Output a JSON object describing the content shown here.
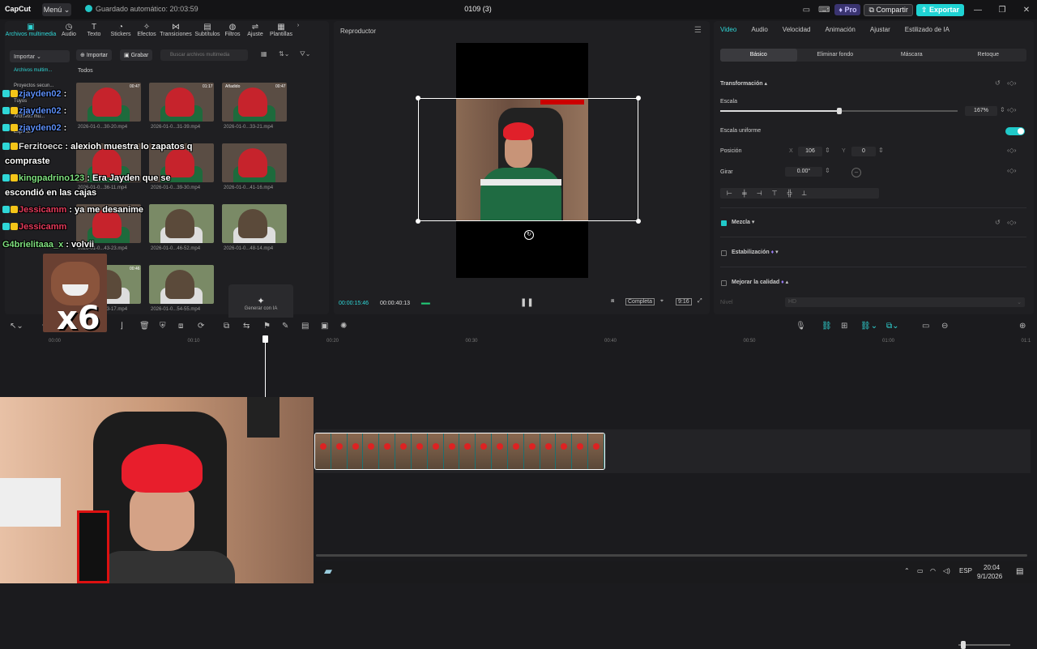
{
  "titlebar": {
    "logo": "CapCut",
    "menu": "Menú",
    "autosave": "Guardado automático: 20:03:59",
    "project": "0109 (3)",
    "pro": "Pro",
    "share": "Compartir",
    "export": "Exportar"
  },
  "left": {
    "tabs": [
      {
        "label": "Archivos multimedia",
        "icon": "media-icon"
      },
      {
        "label": "Audio",
        "icon": "audio-icon"
      },
      {
        "label": "Texto",
        "icon": "text-icon"
      },
      {
        "label": "Stickers",
        "icon": "sticker-icon"
      },
      {
        "label": "Efectos",
        "icon": "effects-icon"
      },
      {
        "label": "Transiciones",
        "icon": "transition-icon"
      },
      {
        "label": "Subtítulos",
        "icon": "subtitle-icon"
      },
      {
        "label": "Filtros",
        "icon": "filter-icon"
      },
      {
        "label": "Ajuste",
        "icon": "adjust-icon"
      },
      {
        "label": "Plantillas",
        "icon": "template-icon"
      }
    ],
    "sidebar": {
      "import": "Importar",
      "items": [
        "Archivos multim...",
        "Proyectos secun...",
        "Tuyos",
        "Archivos mu...",
        "Espacios"
      ]
    },
    "import_btn": "Importar",
    "record_btn": "Grabar",
    "search_placeholder": "Buscar archivos multimedia",
    "todos": "Todos",
    "thumbs": [
      {
        "caption": "2026-01-0...30-20.mp4",
        "duration": "00:47"
      },
      {
        "caption": "2026-01-0...31-39.mp4",
        "duration": "01:17"
      },
      {
        "caption": "2026-01-0...33-21.mp4",
        "duration": "00:47",
        "badge": "Añadido"
      },
      {
        "caption": "2026-01-0...36-11.mp4",
        "duration": ""
      },
      {
        "caption": "2026-01-0...39-30.mp4",
        "duration": ""
      },
      {
        "caption": "2026-01-0...41-16.mp4",
        "duration": ""
      },
      {
        "caption": "2026-01-0...43-23.mp4",
        "duration": ""
      },
      {
        "caption": "2026-01-0...46-52.mp4",
        "duration": ""
      },
      {
        "caption": "2026-01-0...48-14.mp4",
        "duration": ""
      },
      {
        "caption": "2026-01-0...53-17.mp4",
        "duration": "00:46"
      },
      {
        "caption": "2026-01-0...54-55.mp4",
        "duration": ""
      }
    ],
    "generate": "Generar con IA"
  },
  "player": {
    "title": "Reproductor",
    "current": "00:00:15:46",
    "total": "00:00:40:13",
    "ratio_btn": "Completa",
    "aspect": "9:16"
  },
  "right": {
    "tabs": [
      "Video",
      "Audio",
      "Velocidad",
      "Animación",
      "Ajustar",
      "Estilizado de IA"
    ],
    "subtabs": [
      "Básico",
      "Eliminar fondo",
      "Máscara",
      "Retoque"
    ],
    "transform": "Transformación",
    "scale_label": "Escala",
    "scale_value": "167%",
    "scale_level": 0.5,
    "uniform_label": "Escala uniforme",
    "position_label": "Posición",
    "pos_x_label": "X",
    "pos_x": "106",
    "pos_y_label": "Y",
    "pos_y": "0",
    "rotate_label": "Girar",
    "rotate_value": "0.00°",
    "blend": "Mezcla",
    "stabilize": "Estabilización",
    "enhance": "Mejorar la calidad",
    "level_label": "Nivel",
    "level_value": "HD"
  },
  "timeline": {
    "ruler": [
      "00:00",
      "00:10",
      "00:20",
      "00:30",
      "00:40",
      "00:50",
      "01:00",
      "01:1"
    ]
  },
  "chat": [
    {
      "user": "zjayden02",
      "text": ":",
      "color": "u1",
      "badge": true
    },
    {
      "user": "zjayden02",
      "text": ":",
      "color": "u1",
      "badge": true
    },
    {
      "user": "zjayden02",
      "text": ":",
      "color": "u1",
      "badge": true
    },
    {
      "user": "Ferzitoecc",
      "text": ": alexioh muestra lo zapatos q",
      "color": "u2",
      "badge": true
    },
    {
      "user": "",
      "text": "compraste",
      "color": "u2",
      "badge": false
    },
    {
      "user": "kingpadrino123",
      "text": ": Era Jayden que se",
      "color": "u3",
      "badge": true
    },
    {
      "user": "",
      "text": "escondió en las cajas",
      "color": "u2",
      "badge": false
    },
    {
      "user": "Jessicamm",
      "text": ": ya me desanime",
      "color": "u4",
      "badge": true
    },
    {
      "user": "Jessicamm",
      "text": "",
      "color": "u4",
      "badge": true
    },
    {
      "user": "G4brielitaaa_x",
      "text": ": volvii",
      "color": "u3",
      "badge": false
    }
  ],
  "emote_text": "x6",
  "taskbar": {
    "lang": "ESP",
    "time": "20:04",
    "date": "9/1/2026"
  }
}
